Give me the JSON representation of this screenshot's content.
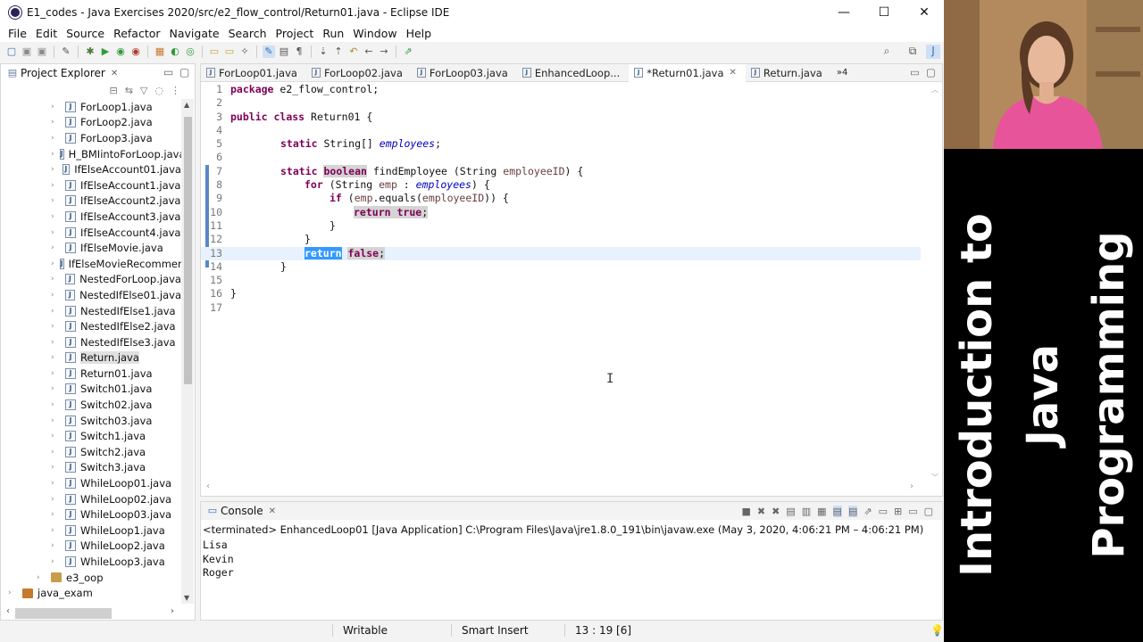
{
  "window": {
    "title": "E1_codes - Java Exercises 2020/src/e2_flow_control/Return01.java - Eclipse IDE",
    "minimize": "—",
    "maximize": "☐",
    "close": "✕"
  },
  "menu": [
    "File",
    "Edit",
    "Source",
    "Refactor",
    "Navigate",
    "Search",
    "Project",
    "Run",
    "Window",
    "Help"
  ],
  "explorer": {
    "title": "Project Explorer",
    "close": "✕",
    "files": [
      "ForLoop1.java",
      "ForLoop2.java",
      "ForLoop3.java",
      "H_BMIintoForLoop.java",
      "IfElseAccount01.java",
      "IfElseAccount1.java",
      "IfElseAccount2.java",
      "IfElseAccount3.java",
      "IfElseAccount4.java",
      "IfElseMovie.java",
      "IfElseMovieRecommen",
      "NestedForLoop.java",
      "NestedIfElse01.java",
      "NestedIfElse1.java",
      "NestedIfElse2.java",
      "NestedIfElse3.java",
      "Return.java",
      "Return01.java",
      "Switch01.java",
      "Switch02.java",
      "Switch03.java",
      "Switch1.java",
      "Switch2.java",
      "Switch3.java",
      "WhileLoop01.java",
      "WhileLoop02.java",
      "WhileLoop03.java",
      "WhileLoop1.java",
      "WhileLoop2.java",
      "WhileLoop3.java"
    ],
    "selected_file": "Return.java",
    "package": "e3_oop",
    "project": "java_exam"
  },
  "editor": {
    "tabs": [
      "ForLoop01.java",
      "ForLoop02.java",
      "ForLoop03.java",
      "EnhancedLoop...",
      "*Return01.java",
      "Return.java"
    ],
    "active_tab": "*Return01.java",
    "overflow": "»4",
    "line_numbers": [
      "1",
      "2",
      "3",
      "4",
      "5",
      "6",
      "7",
      "8",
      "9",
      "10",
      "11",
      "12",
      "13",
      "14",
      "15",
      "16",
      "17"
    ],
    "cursor_line": 13,
    "code": {
      "l1_kw": "package",
      "l1_rest": " e2_flow_control;",
      "l3_kw1": "public",
      "l3_kw2": "class",
      "l3_rest": " Return01 {",
      "l5_kw": "static",
      "l5_type": " String[] ",
      "l5_field": "employees",
      "l5_end": ";",
      "l7_kw1": "static",
      "l7_kw2": "boolean",
      "l7_a": " findEmployee (String ",
      "l7_param": "employeeID",
      "l7_b": ") {",
      "l8_kw": "for",
      "l8_a": " (String ",
      "l8_var": "emp",
      "l8_b": " : ",
      "l8_field": "employees",
      "l8_c": ") {",
      "l9_kw": "if",
      "l9_a": " (",
      "l9_var": "emp",
      "l9_b": ".equals(",
      "l9_param": "employeeID",
      "l9_c": ")) {",
      "l10_kw1": "return",
      "l10_kw2": "true",
      "l10_end": ";",
      "l11": "}",
      "l12": "}",
      "l13_kw1": "return",
      "l13_kw2": "false",
      "l13_end": ";",
      "l14": "}",
      "l16": "}"
    }
  },
  "console": {
    "title": "Console",
    "header": "<terminated> EnhancedLoop01 [Java Application] C:\\Program Files\\Java\\jre1.8.0_191\\bin\\javaw.exe  (May 3, 2020, 4:06:21 PM – 4:06:21 PM)",
    "output": [
      "Lisa",
      "Kevin",
      "Roger"
    ]
  },
  "status": {
    "mode": "Writable",
    "insert": "Smart Insert",
    "position": "13 : 19 [6]"
  },
  "overlay": {
    "line1": "Introduction to Java",
    "line2": "Programming"
  },
  "colors": {
    "keyword": "#7f0055",
    "field": "#0000c0",
    "selection": "#3399ff",
    "banner_bg": "#000000"
  }
}
